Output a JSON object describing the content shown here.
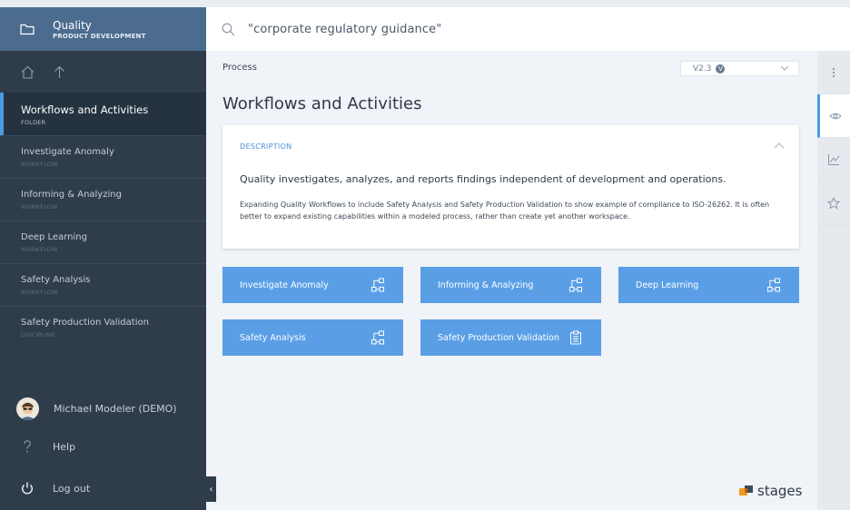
{
  "sidebar": {
    "header": {
      "title": "Quality",
      "subtitle": "PRODUCT DEVELOPMENT"
    },
    "items": [
      {
        "name": "Workflows and Activities",
        "kind": "FOLDER"
      },
      {
        "name": "Investigate Anomaly",
        "kind": "WORKFLOW"
      },
      {
        "name": "Informing & Analyzing",
        "kind": "WORKFLOW"
      },
      {
        "name": "Deep Learning",
        "kind": "WORKFLOW"
      },
      {
        "name": "Safety Analysis",
        "kind": "WORKFLOW"
      },
      {
        "name": "Safety Production Validation",
        "kind": "DISCIPLINE"
      }
    ],
    "user": "Michael Modeler (DEMO)",
    "help": "Help",
    "logout": "Log out"
  },
  "search": {
    "query": "\"corporate regulatory guidance\""
  },
  "main": {
    "breadcrumb": "Process",
    "version": "V2.3",
    "version_badge": "V",
    "title": "Workflows and Activities",
    "description": {
      "label": "DESCRIPTION",
      "lead": "Quality investigates, analyzes, and reports findings independent of development and operations.",
      "body": "Expanding Quality Workflows to include Safety Analysis and Safety Production Validation to show example of compliance to ISO-26262.  It is often better to expand existing capabilities within a modeled process, rather than create yet another workspace."
    },
    "tiles": [
      {
        "label": "Investigate Anomaly",
        "icon": "workflow-icon"
      },
      {
        "label": "Informing & Analyzing",
        "icon": "workflow-icon"
      },
      {
        "label": "Deep Learning",
        "icon": "workflow-icon"
      },
      {
        "label": "Safety Analysis",
        "icon": "workflow-icon"
      },
      {
        "label": "Safety Production Validation",
        "icon": "clipboard-icon"
      }
    ]
  },
  "brand": {
    "name": "stages"
  },
  "colors": {
    "accent": "#5a9fe6",
    "sidebar": "#2f3d4b",
    "header": "#4b6c8e"
  }
}
